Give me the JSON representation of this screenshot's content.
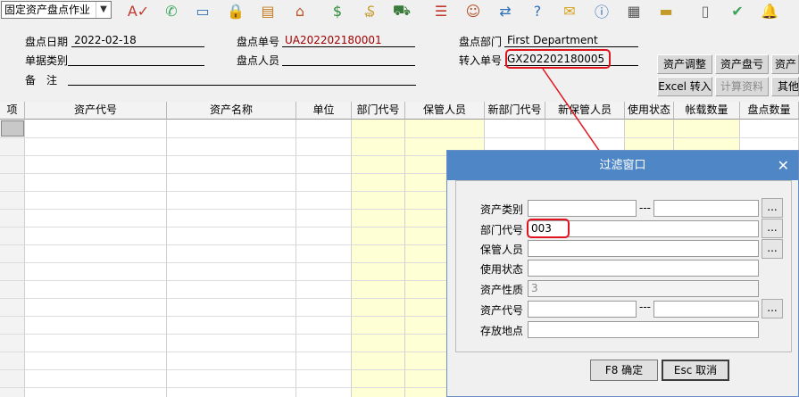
{
  "toolbar": {
    "module_select": "固定资产盘点作业",
    "icons": [
      "spellcheck-icon",
      "phone-icon",
      "computer-icon",
      "lock-icon",
      "briefcase-icon",
      "home-icon",
      "dollar-icon",
      "money-bag-icon",
      "cart-icon",
      "clipboard-icon",
      "users-icon",
      "transfer-icon",
      "help-doc-icon",
      "mail-icon",
      "info-icon",
      "calculator-icon",
      "folder-icon",
      "document-icon",
      "check-icon",
      "bell-icon"
    ]
  },
  "form": {
    "date_label": "盘点日期",
    "date_value": "2022-02-18",
    "doc_type_label": "单据类别",
    "doc_type_value": "",
    "remark_label": "备　注",
    "remark_value": "",
    "inv_no_label": "盘点单号",
    "inv_no_value": "UA202202180001",
    "inv_person_label": "盘点人员",
    "inv_person_value": "",
    "dept_label": "盘点部门",
    "dept_value": "First Department",
    "transfer_label": "转入单号",
    "transfer_value": "GX202202180005"
  },
  "buttons": {
    "adjust": "资产调整",
    "loss": "资产盘亏",
    "gain": "资产",
    "excel": "Excel 转入",
    "calc": "计算资料",
    "other": "其他"
  },
  "grid": {
    "headers": [
      "项",
      "资产代号",
      "资产名称",
      "单位",
      "部门代号",
      "保管人员",
      "新部门代号",
      "新保管人员",
      "使用状态",
      "帐载数量",
      "盘点数量"
    ]
  },
  "dialog": {
    "title": "过滤窗口",
    "fields": {
      "asset_category": "资产类别",
      "dept_code": "部门代号",
      "dept_code_value": "003",
      "custodian": "保管人员",
      "use_status": "使用状态",
      "asset_nature": "资产性质",
      "asset_nature_value": "3",
      "asset_code": "资产代号",
      "location": "存放地点"
    },
    "range_sep": "---",
    "dots": "...",
    "ok": "F8 确定",
    "cancel": "Esc 取消"
  },
  "colors": {
    "accent": "#4f86c6",
    "highlight": "#e0141e",
    "grid_yellow": "#ffffd5",
    "value_red": "#a00000"
  }
}
